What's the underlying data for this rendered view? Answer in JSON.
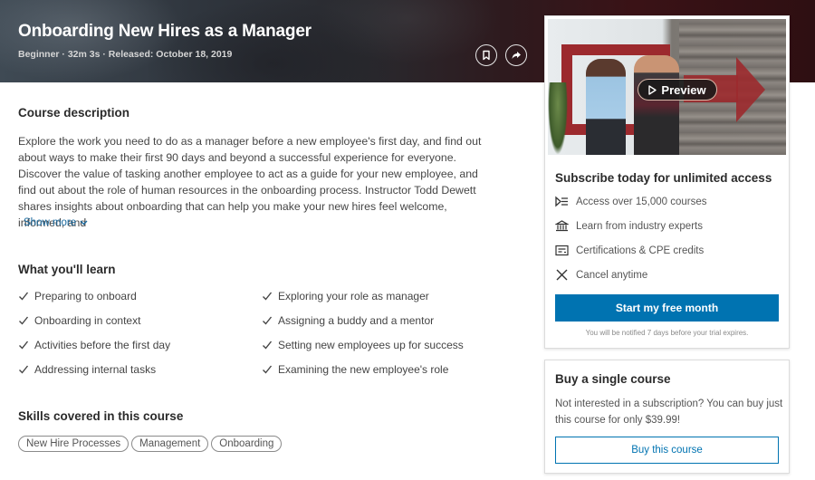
{
  "header": {
    "title": "Onboarding New Hires as a Manager",
    "meta": "Beginner · 32m 3s · Released: October 18, 2019",
    "save_icon": "bookmark-icon",
    "share_icon": "share-icon"
  },
  "description": {
    "title": "Course description",
    "text": "Explore the work you need to do as a manager before a new employee's first day, and find out about ways to make their first 90 days and beyond a successful experience for everyone. Discover the value of tasking another employee to act as a guide for your new employee, and find out about the role of human resources in the onboarding process. Instructor Todd Dewett shares insights about onboarding that can help you make your new hires feel welcome, informed, and",
    "show_more": "Show more"
  },
  "learn": {
    "title": "What you'll learn",
    "items": [
      "Preparing to onboard",
      "Exploring your role as manager",
      "Onboarding in context",
      "Assigning a buddy and a mentor",
      "Activities before the first day",
      "Setting new employees up for success",
      "Addressing internal tasks",
      "Examining the new employee's role"
    ]
  },
  "skills": {
    "title": "Skills covered in this course",
    "items": [
      "New Hire Processes",
      "Management",
      "Onboarding"
    ]
  },
  "subscribe": {
    "preview_label": "Preview",
    "title": "Subscribe today for unlimited access",
    "perks": [
      {
        "icon": "course-list-icon",
        "label": "Access over 15,000 courses"
      },
      {
        "icon": "institution-icon",
        "label": "Learn from industry experts"
      },
      {
        "icon": "certificate-icon",
        "label": "Certifications & CPE credits"
      },
      {
        "icon": "close-icon",
        "label": "Cancel anytime"
      }
    ],
    "cta": "Start my free month",
    "notice": "You will be notified 7 days before your trial expires.",
    "accent": "#0073b1"
  },
  "buy": {
    "title": "Buy a single course",
    "text": "Not interested in a subscription? You can buy just this course for only $39.99!",
    "cta": "Buy this course"
  }
}
